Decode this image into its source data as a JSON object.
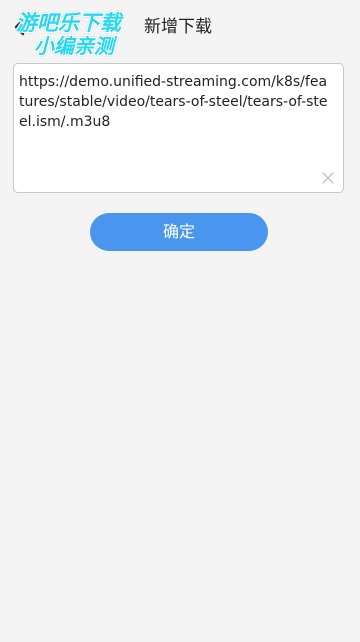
{
  "header": {
    "title": "新增下载",
    "back_icon": "back-arrow-icon"
  },
  "watermark": {
    "line1": "游吧乐下载",
    "line2": "小编亲测",
    "color": "#27d8ee"
  },
  "url_input": {
    "value": "https://demo.unified-streaming.com/k8s/features/stable/video/tears-of-steel/tears-of-steel.ism/.m3u8",
    "clear_icon": "close-icon"
  },
  "confirm_button": {
    "label": "确定",
    "color": "#4a96ee"
  }
}
